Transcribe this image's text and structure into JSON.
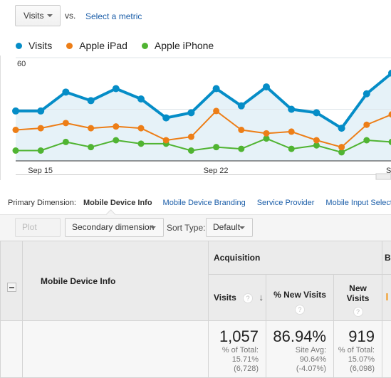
{
  "metric_picker": {
    "selected": "Visits",
    "vs_label": "vs.",
    "select_metric_link": "Select a metric"
  },
  "legend": [
    {
      "label": "Visits",
      "color": "#058dc7"
    },
    {
      "label": "Apple iPad",
      "color": "#ed7e17"
    },
    {
      "label": "Apple iPhone",
      "color": "#50b432"
    }
  ],
  "chart_data": {
    "type": "line",
    "title": "",
    "xlabel": "",
    "ylabel": "",
    "ylim": [
      0,
      60
    ],
    "yticks": [
      30,
      60
    ],
    "grid": true,
    "legend_position": "top-left",
    "x_tick_labels": [
      {
        "label": "Sep 15",
        "index": 1
      },
      {
        "label": "Sep 22",
        "index": 8
      },
      {
        "label": "Se",
        "index": 15
      }
    ],
    "x": [
      "Sep 14",
      "Sep 15",
      "Sep 16",
      "Sep 17",
      "Sep 18",
      "Sep 19",
      "Sep 20",
      "Sep 21",
      "Sep 22",
      "Sep 23",
      "Sep 24",
      "Sep 25",
      "Sep 26",
      "Sep 27",
      "Sep 28",
      "Sep 29"
    ],
    "series": [
      {
        "name": "Visits",
        "color": "#058dc7",
        "area": true,
        "values": [
          29,
          29,
          40,
          35,
          42,
          36,
          25,
          28,
          42,
          32,
          43,
          30,
          28,
          19,
          39,
          51
        ]
      },
      {
        "name": "Apple iPad",
        "color": "#ed7e17",
        "values": [
          18,
          19,
          22,
          19,
          20,
          19,
          12,
          14,
          29,
          18,
          16,
          17,
          12,
          8,
          21,
          27
        ]
      },
      {
        "name": "Apple iPhone",
        "color": "#50b432",
        "values": [
          6,
          6,
          11,
          8,
          12,
          10,
          10,
          6,
          8,
          7,
          13,
          7,
          9,
          5,
          12,
          11
        ]
      }
    ]
  },
  "primary_dimension": {
    "label": "Primary Dimension:",
    "active": "Mobile Device Info",
    "links": [
      "Mobile Device Branding",
      "Service Provider",
      "Mobile Input Selector"
    ]
  },
  "toolbar": {
    "plot_rows": "Plot Rows",
    "secondary_dimension": "Secondary dimension",
    "sort_type_label": "Sort Type:",
    "sort_type_value": "Default"
  },
  "table": {
    "dimension_header": "Mobile Device Info",
    "group_header": "Acquisition",
    "next_group_header_partial": "B",
    "columns": [
      {
        "label": "Visits",
        "help": "?",
        "sort": "desc"
      },
      {
        "label": "% New Visits",
        "help": "?"
      },
      {
        "label": "New Visits",
        "help": "?"
      }
    ],
    "totals": [
      {
        "value": "1,057",
        "line1": "% of Total:",
        "line2": "15.71%",
        "line3": "(6,728)"
      },
      {
        "value": "86.94%",
        "line1": "Site Avg:",
        "line2": "90.64%",
        "line3": "(-4.07%)"
      },
      {
        "value": "919",
        "line1": "% of Total:",
        "line2": "15.07%",
        "line3": "(6,098)"
      }
    ]
  }
}
